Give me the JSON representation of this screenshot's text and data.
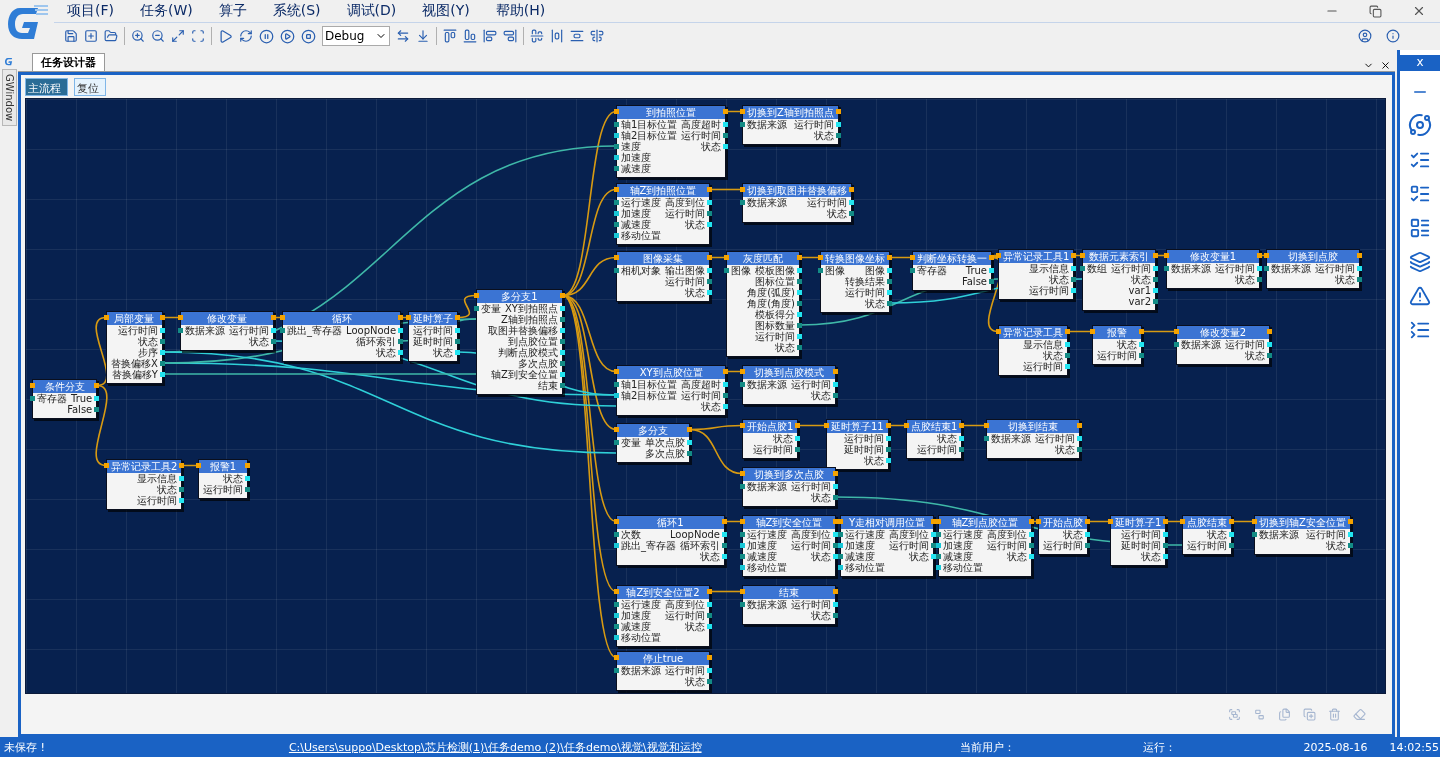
{
  "menu": [
    "项目(F)",
    "任务(W)",
    "算子",
    "系统(S)",
    "调试(D)",
    "视图(Y)",
    "帮助(H)"
  ],
  "toolbar": {
    "mode": "Debug"
  },
  "side_tab": "GWindow",
  "document": {
    "tab": "任务设计器",
    "subtabs": [
      {
        "label": "主流程",
        "selected": true
      },
      {
        "label": "复位",
        "selected": false
      }
    ],
    "nodes": [
      {
        "title": "条件分支",
        "rows": [
          {
            "in": "寄存器",
            "out": "True"
          },
          {
            "out": "False"
          }
        ]
      },
      {
        "title": "局部变量",
        "rows": [
          {
            "out": "运行时间"
          },
          {
            "out": "状态"
          },
          {
            "out": "步序"
          },
          {
            "out": "替换偏移X"
          },
          {
            "out": "替换偏移Y"
          }
        ]
      },
      {
        "title": "修改变量",
        "rows": [
          {
            "in": "数据来源",
            "out": "运行时间"
          },
          {
            "out": "状态"
          }
        ]
      },
      {
        "title": "循环",
        "rows": [
          {
            "in": "跳出_寄存器",
            "out": "LoopNode"
          },
          {
            "out": "循环索引"
          },
          {
            "out": "状态"
          }
        ]
      },
      {
        "title": "延时算子",
        "rows": [
          {
            "out": "运行时间"
          },
          {
            "out": "延时时间"
          },
          {
            "out": "状态"
          }
        ]
      },
      {
        "title": "多分支1",
        "rows": [
          {
            "in": "变量",
            "out": "XY到拍照点"
          },
          {
            "out": "Z轴到拍照点"
          },
          {
            "out": "取图并替换偏移"
          },
          {
            "out": "到点胶位置"
          },
          {
            "out": "判断点胶模式"
          },
          {
            "out": "多次点胶"
          },
          {
            "out": "轴Z到安全位置"
          },
          {
            "out": "结束"
          }
        ]
      },
      {
        "title": "到拍照位置",
        "rows": [
          {
            "in": "轴1目标位置",
            "out": "高度超时"
          },
          {
            "in": "轴2目标位置",
            "out": "运行时间"
          },
          {
            "in": "速度",
            "out": "状态"
          },
          {
            "in": "加速度"
          },
          {
            "in": "减速度"
          }
        ]
      },
      {
        "title": "切换到Z轴到拍照点",
        "rows": [
          {
            "in": "数据来源",
            "out": "运行时间"
          },
          {
            "out": "状态"
          }
        ]
      },
      {
        "title": "轴Z到拍照位置",
        "rows": [
          {
            "in": "运行速度",
            "out": "高度到位"
          },
          {
            "in": "加速度",
            "out": "运行时间"
          },
          {
            "in": "减速度",
            "out": "状态"
          },
          {
            "in": "移动位置"
          }
        ]
      },
      {
        "title": "切换到取图并替换偏移",
        "rows": [
          {
            "in": "数据来源",
            "out": "运行时间"
          },
          {
            "out": "状态"
          }
        ]
      },
      {
        "title": "图像采集",
        "rows": [
          {
            "in": "相机对象",
            "out": "输出图像"
          },
          {
            "out": "运行时间"
          },
          {
            "out": "状态"
          }
        ]
      },
      {
        "title": "灰度匹配",
        "rows": [
          {
            "in": "图像",
            "out": "模板图像"
          },
          {
            "out": "图标位置"
          },
          {
            "out": "角度(弧度)"
          },
          {
            "out": "角度(角度)"
          },
          {
            "out": "模板得分"
          },
          {
            "out": "图标数量"
          },
          {
            "out": "运行时间"
          },
          {
            "out": "状态"
          }
        ]
      },
      {
        "title": "转换图像坐标",
        "rows": [
          {
            "in": "图像",
            "out": "图像"
          },
          {
            "out": "转换结果"
          },
          {
            "out": "运行时间"
          },
          {
            "out": "状态"
          }
        ]
      },
      {
        "title": "判断坐标转换一",
        "rows": [
          {
            "in": "寄存器",
            "out": "True"
          },
          {
            "out": "False"
          }
        ]
      },
      {
        "title": "异常记录工具1",
        "rows": [
          {
            "out": "显示信息"
          },
          {
            "out": "状态"
          },
          {
            "out": "运行时间"
          }
        ]
      },
      {
        "title": "数据元素索引",
        "rows": [
          {
            "in": "数组",
            "out": "运行时间"
          },
          {
            "out": "状态"
          },
          {
            "out": "var1"
          },
          {
            "out": "var2"
          }
        ]
      },
      {
        "title": "修改变量1",
        "rows": [
          {
            "in": "数据来源",
            "out": "运行时间"
          },
          {
            "out": "状态"
          }
        ]
      },
      {
        "title": "切换到点胶",
        "rows": [
          {
            "in": "数据来源",
            "out": "运行时间"
          },
          {
            "out": "状态"
          }
        ]
      },
      {
        "title": "异常记录工具",
        "rows": [
          {
            "out": "显示信息"
          },
          {
            "out": "状态"
          },
          {
            "out": "运行时间"
          }
        ]
      },
      {
        "title": "报警",
        "rows": [
          {
            "out": "状态"
          },
          {
            "out": "运行时间"
          }
        ]
      },
      {
        "title": "修改变量2",
        "rows": [
          {
            "in": "数据来源",
            "out": "运行时间"
          },
          {
            "out": "状态"
          }
        ]
      },
      {
        "title": "XY到点胶位置",
        "rows": [
          {
            "in": "轴1目标位置",
            "out": "高度超时"
          },
          {
            "in": "轴2目标位置",
            "out": "运行时间"
          },
          {
            "out": "状态"
          }
        ]
      },
      {
        "title": "切换到点胶模式",
        "rows": [
          {
            "in": "数据来源",
            "out": "运行时间"
          },
          {
            "out": "状态"
          }
        ]
      },
      {
        "title": "多分支",
        "rows": [
          {
            "in": "变量",
            "out": "单次点胶"
          },
          {
            "out": "多次点胶"
          }
        ]
      },
      {
        "title": "开始点胶1",
        "rows": [
          {
            "out": "状态"
          },
          {
            "out": "运行时间"
          }
        ]
      },
      {
        "title": "延时算子11",
        "rows": [
          {
            "out": "运行时间"
          },
          {
            "out": "延时时间"
          },
          {
            "out": "状态"
          }
        ]
      },
      {
        "title": "点胶结束1",
        "rows": [
          {
            "out": "状态"
          },
          {
            "out": "运行时间"
          }
        ]
      },
      {
        "title": "切换到结束",
        "rows": [
          {
            "in": "数据来源",
            "out": "运行时间"
          },
          {
            "out": "状态"
          }
        ]
      },
      {
        "title": "切换到多次点胶",
        "rows": [
          {
            "in": "数据来源",
            "out": "运行时间"
          },
          {
            "out": "状态"
          }
        ]
      },
      {
        "title": "循环1",
        "rows": [
          {
            "in": "次数",
            "out": "LoopNode"
          },
          {
            "in": "跳出_寄存器",
            "out": "循环索引"
          },
          {
            "out": "状态"
          }
        ]
      },
      {
        "title": "轴Z到安全位置",
        "rows": [
          {
            "in": "运行速度",
            "out": "高度到位"
          },
          {
            "in": "加速度",
            "out": "运行时间"
          },
          {
            "in": "减速度",
            "out": "状态"
          },
          {
            "in": "移动位置"
          }
        ]
      },
      {
        "title": "Y走相对调用位置",
        "rows": [
          {
            "in": "运行速度",
            "out": "高度到位"
          },
          {
            "in": "加速度",
            "out": "运行时间"
          },
          {
            "in": "减速度",
            "out": "状态"
          },
          {
            "in": "移动位置"
          }
        ]
      },
      {
        "title": "轴Z到点胶位置",
        "rows": [
          {
            "in": "运行速度",
            "out": "高度到位"
          },
          {
            "in": "加速度",
            "out": "运行时间"
          },
          {
            "in": "减速度",
            "out": "状态"
          },
          {
            "in": "移动位置"
          }
        ]
      },
      {
        "title": "开始点胶",
        "rows": [
          {
            "out": "状态"
          },
          {
            "out": "运行时间"
          }
        ]
      },
      {
        "title": "延时算子1",
        "rows": [
          {
            "out": "运行时间"
          },
          {
            "out": "延时时间"
          },
          {
            "out": "状态"
          }
        ]
      },
      {
        "title": "点胶结束",
        "rows": [
          {
            "out": "状态"
          },
          {
            "out": "运行时间"
          }
        ]
      },
      {
        "title": "切换到轴Z安全位置",
        "rows": [
          {
            "in": "数据来源",
            "out": "运行时间"
          },
          {
            "out": "状态"
          }
        ]
      },
      {
        "title": "轴Z到安全位置2",
        "rows": [
          {
            "in": "运行速度",
            "out": "高度到位"
          },
          {
            "in": "加速度",
            "out": "运行时间"
          },
          {
            "in": "减速度",
            "out": "状态"
          },
          {
            "in": "移动位置"
          }
        ]
      },
      {
        "title": "结束",
        "rows": [
          {
            "in": "数据来源",
            "out": "运行时间"
          },
          {
            "out": "状态"
          }
        ]
      },
      {
        "title": "停止true",
        "rows": [
          {
            "in": "数据来源",
            "out": "运行时间"
          },
          {
            "out": "状态"
          }
        ]
      },
      {
        "title": "异常记录工具2",
        "rows": [
          {
            "out": "显示信息"
          },
          {
            "out": "状态"
          },
          {
            "out": "运行时间"
          }
        ]
      },
      {
        "title": "报警1",
        "rows": [
          {
            "out": "状态"
          },
          {
            "out": "运行时间"
          }
        ]
      }
    ]
  },
  "right_panel": {
    "close": "x"
  },
  "status_bar": {
    "save_state": "未保存 !",
    "path": "C:\\Users\\suppo\\Desktop\\芯片检测(1)\\任务demo (2)\\任务demo\\视觉\\视觉和运控",
    "user_label": "当前用户：",
    "run_label": "运行：",
    "date": "2025-08-16",
    "time": "14:02:55"
  }
}
